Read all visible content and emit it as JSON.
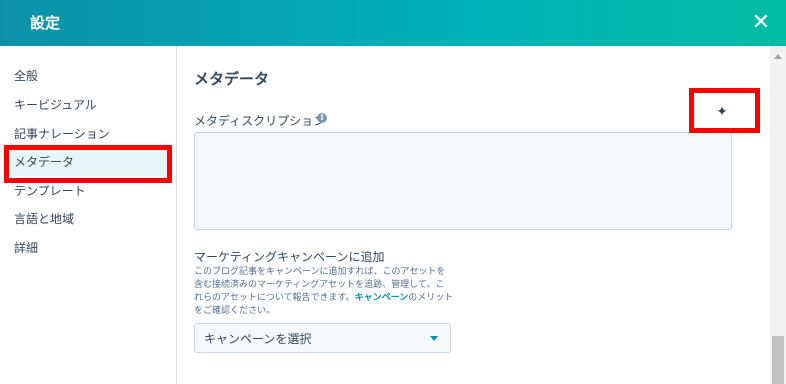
{
  "header": {
    "title": "設定",
    "close_icon": "close-icon"
  },
  "sidebar": {
    "items": [
      {
        "label": "全般"
      },
      {
        "label": "キービジュアル"
      },
      {
        "label": "記事ナレーション"
      },
      {
        "label": "メタデータ"
      },
      {
        "label": "テンプレート"
      },
      {
        "label": "言語と地域"
      },
      {
        "label": "詳細"
      }
    ],
    "active_index": 3
  },
  "main": {
    "section_title": "メタデータ",
    "meta_description": {
      "label": "メタディスクリプション",
      "value": "",
      "ai_icon": "sparkle-icon"
    },
    "campaign": {
      "label": "マーケティングキャンペーンに追加",
      "description_lines": [
        "このブログ記事をキャンペーンに追加すれば、このアセットを",
        "含む接続済みのマーケティングアセットを追跡、管理して、こ",
        "れらのアセットについて報告できます。",
        "キャンペーン",
        "のメリット",
        "をご確認ください。"
      ],
      "select_value": "キャンペーンを選択"
    }
  },
  "colors": {
    "accent": "#0091ae",
    "highlight": "#ff0000",
    "header_start": "#0c91ab",
    "header_end": "#00bda5"
  }
}
